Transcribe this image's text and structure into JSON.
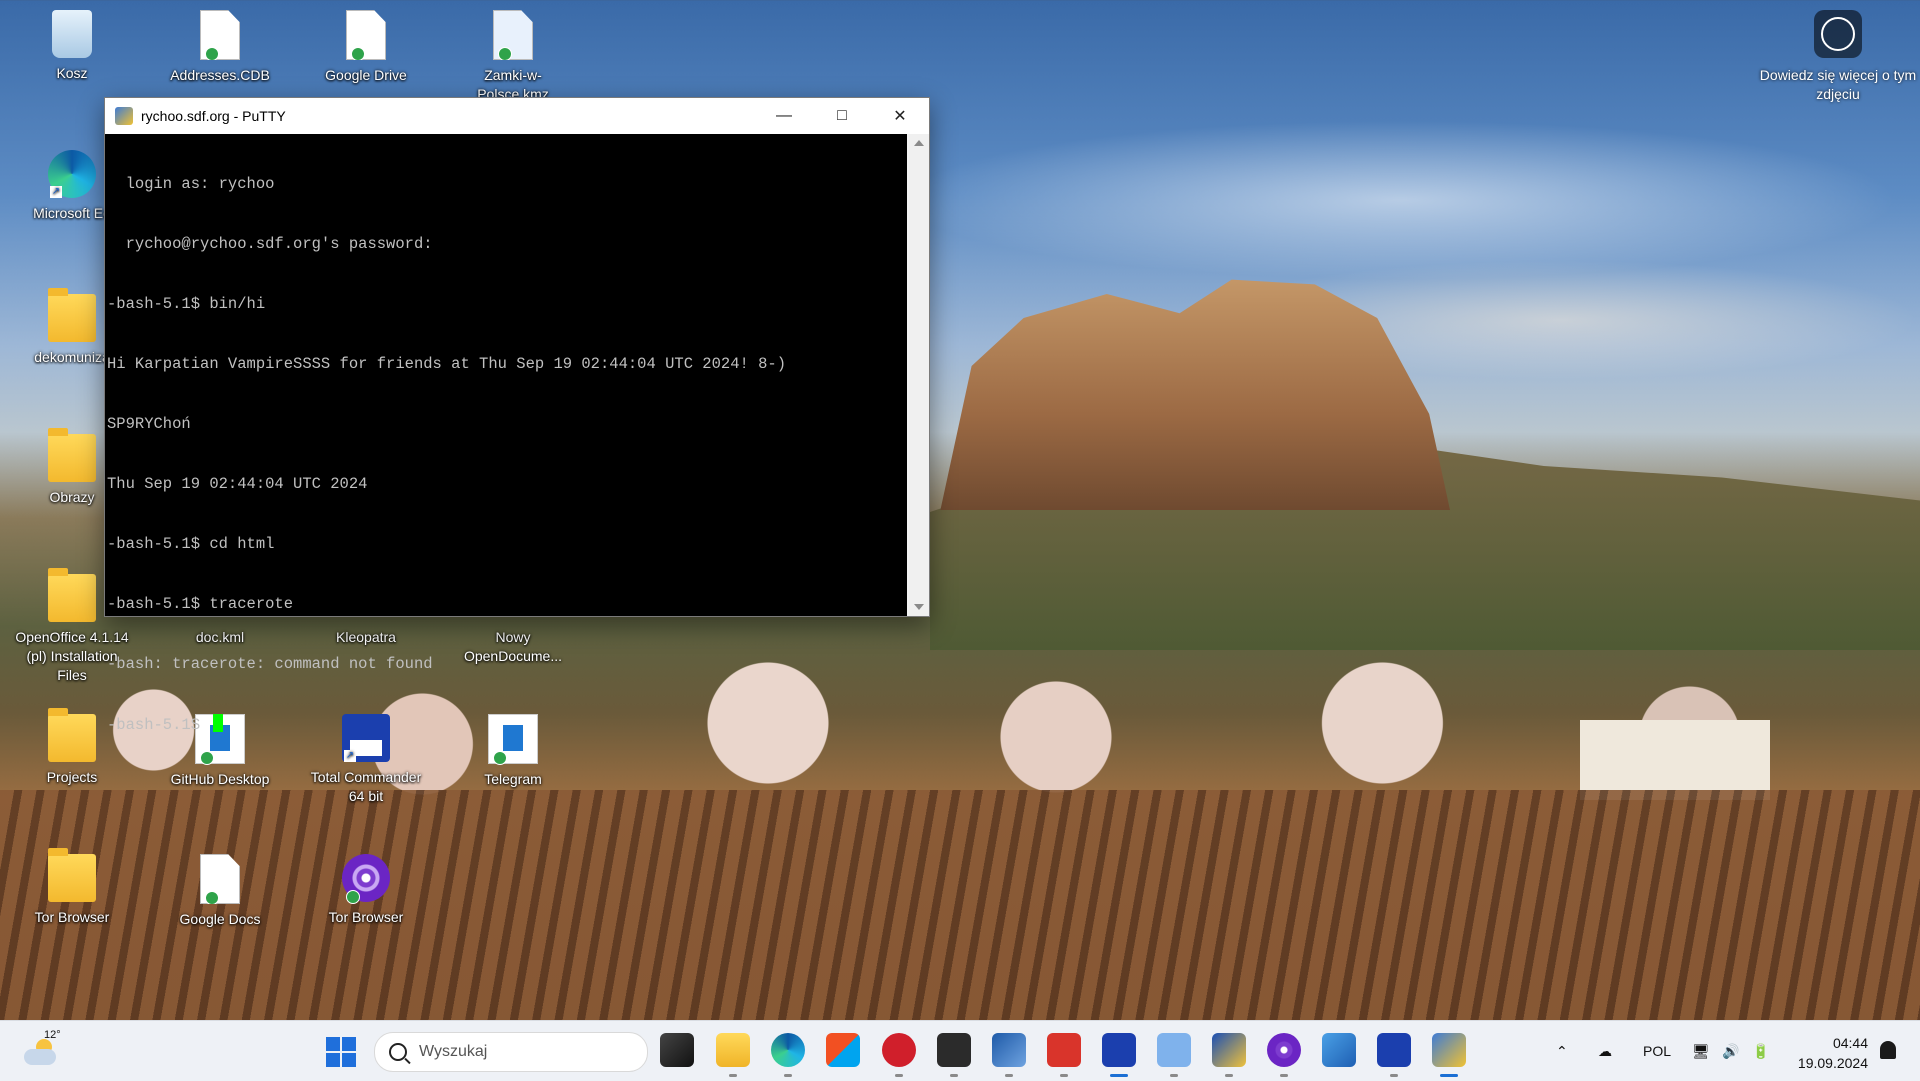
{
  "desktop": {
    "icons": [
      {
        "label": "Kosz",
        "icon": "recycle-bin-icon"
      },
      {
        "label": "Addresses.CDB",
        "icon": "document-icon"
      },
      {
        "label": "Google Drive",
        "icon": "document-icon"
      },
      {
        "label": "Zamki-w-Polsce.kmz",
        "icon": "kmz-file-icon"
      },
      {
        "label": "Microsoft Ed",
        "icon": "edge-icon"
      },
      {
        "label": "dekomuniza",
        "icon": "folder-icon"
      },
      {
        "label": "Obrazy",
        "icon": "folder-icon"
      },
      {
        "label": "OpenOffice 4.1.14 (pl) Installation Files",
        "icon": "folder-icon"
      },
      {
        "label": "doc.kml",
        "icon": "document-icon"
      },
      {
        "label": "Kleopatra",
        "icon": "kleopatra-icon"
      },
      {
        "label": "Nowy OpenDocume...",
        "icon": "document-icon"
      },
      {
        "label": "Projects",
        "icon": "folder-icon"
      },
      {
        "label": "GitHub Desktop",
        "icon": "github-desktop-icon"
      },
      {
        "label": "Total Commander 64 bit",
        "icon": "total-commander-icon"
      },
      {
        "label": "Telegram",
        "icon": "telegram-icon"
      },
      {
        "label": "Tor Browser",
        "icon": "folder-icon"
      },
      {
        "label": "Google Docs",
        "icon": "document-icon"
      },
      {
        "label": "Tor Browser",
        "icon": "tor-browser-icon"
      }
    ],
    "info_widget": "Dowiedz się więcej o tym zdjęciu"
  },
  "putty": {
    "title": "rychoo.sdf.org - PuTTY",
    "lines": [
      "  login as: rychoo",
      "  rychoo@rychoo.sdf.org's password:",
      "-bash-5.1$ bin/hi",
      "Hi Karpatian VampireSSSS for friends at Thu Sep 19 02:44:04 UTC 2024! 8-)",
      "SP9RYChoń",
      "Thu Sep 19 02:44:04 UTC 2024",
      "-bash-5.1$ cd html",
      "-bash-5.1$ tracerote",
      "-bash: tracerote: command not found",
      "-bash-5.1$ "
    ],
    "cursor_color": "#00ff00"
  },
  "taskbar": {
    "weather_temp": "12°",
    "search_placeholder": "Wyszukaj",
    "apps": [
      "task-view-icon",
      "file-explorer-icon",
      "edge-icon",
      "microsoft-store-icon",
      "app-red-icon",
      "terminal-icon",
      "virtualbox-icon",
      "app-red-square-icon",
      "total-commander-icon",
      "notepad-icon",
      "app-blue-a-icon",
      "tor-browser-icon",
      "paint-icon",
      "save-icon",
      "putty-icon"
    ],
    "language": "POL",
    "time": "04:44",
    "date": "19.09.2024"
  }
}
